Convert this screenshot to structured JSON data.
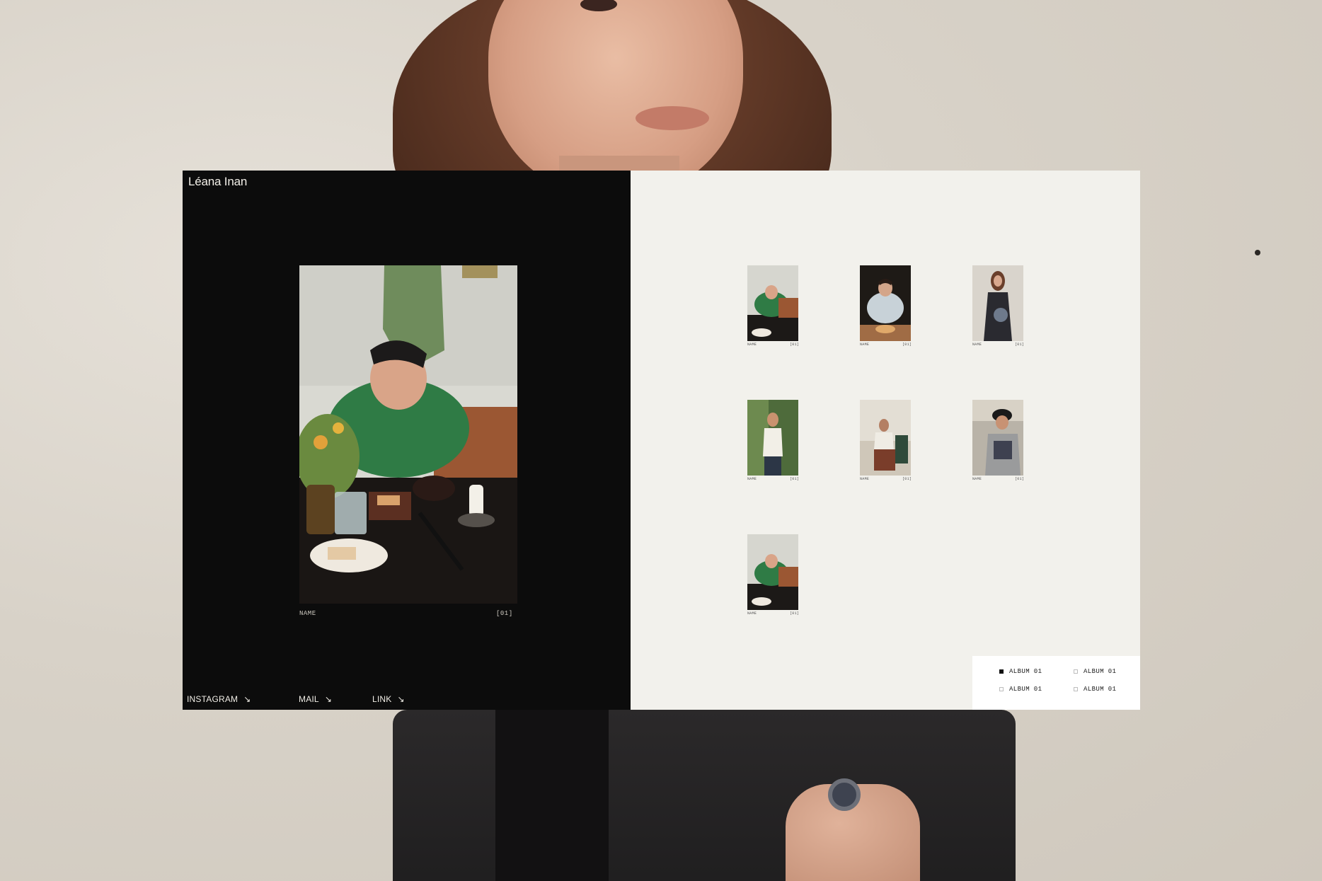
{
  "site": {
    "brand": "Léana Inan",
    "featured": {
      "name": "NAME",
      "index": "[01]"
    },
    "social": [
      {
        "label": "INSTAGRAM",
        "arrow": "↘"
      },
      {
        "label": "MAIL",
        "arrow": "↘"
      },
      {
        "label": "LINK",
        "arrow": "↘"
      }
    ],
    "thumbs": [
      {
        "name": "NAME",
        "index": "[01]"
      },
      {
        "name": "NAME",
        "index": "[01]"
      },
      {
        "name": "NAME",
        "index": "[01]"
      },
      {
        "name": "NAME",
        "index": "[01]"
      },
      {
        "name": "NAME",
        "index": "[01]"
      },
      {
        "name": "NAME",
        "index": "[01]"
      },
      {
        "name": "NAME",
        "index": "[01]"
      }
    ],
    "albums": [
      {
        "label": "ALBUM 01",
        "selected": true
      },
      {
        "label": "ALBUM 01",
        "selected": false
      },
      {
        "label": "ALBUM 01",
        "selected": false
      },
      {
        "label": "ALBUM 01",
        "selected": false
      }
    ]
  }
}
